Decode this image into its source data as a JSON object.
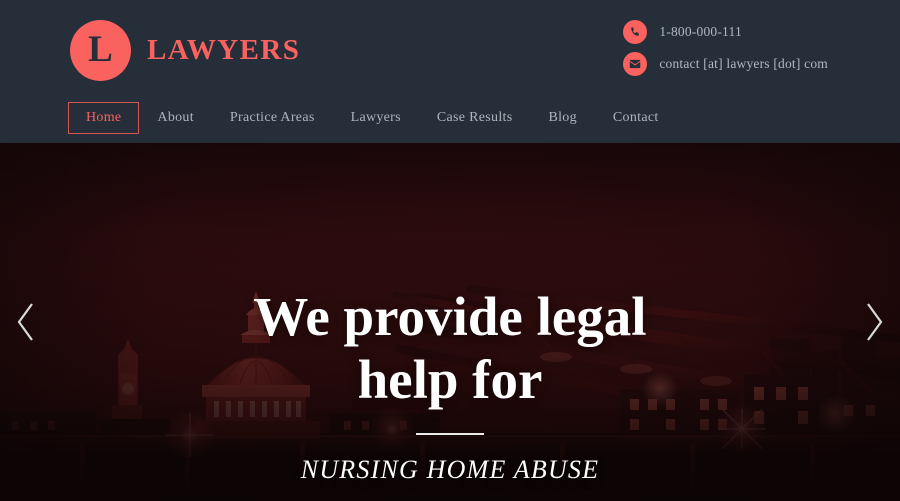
{
  "site": {
    "brand_letter": "L",
    "brand_name": "LAWYERS",
    "accent_color": "#f9625e",
    "header_bg": "#262e39"
  },
  "header": {
    "contacts": [
      {
        "icon": "phone-icon",
        "text": "1-800-000-111"
      },
      {
        "icon": "envelope-icon",
        "text": "contact [at] lawyers [dot] com"
      }
    ],
    "nav": [
      {
        "label": "Home",
        "active": true
      },
      {
        "label": "About",
        "active": false
      },
      {
        "label": "Practice Areas",
        "active": false
      },
      {
        "label": "Lawyers",
        "active": false
      },
      {
        "label": "Case Results",
        "active": false
      },
      {
        "label": "Blog",
        "active": false
      },
      {
        "label": "Contact",
        "active": false
      }
    ]
  },
  "hero": {
    "title_line_1": "We provide legal",
    "title_line_2": "help for",
    "subtitle": "NURSING HOME ABUSE",
    "prev_label": "Previous slide",
    "next_label": "Next slide"
  }
}
